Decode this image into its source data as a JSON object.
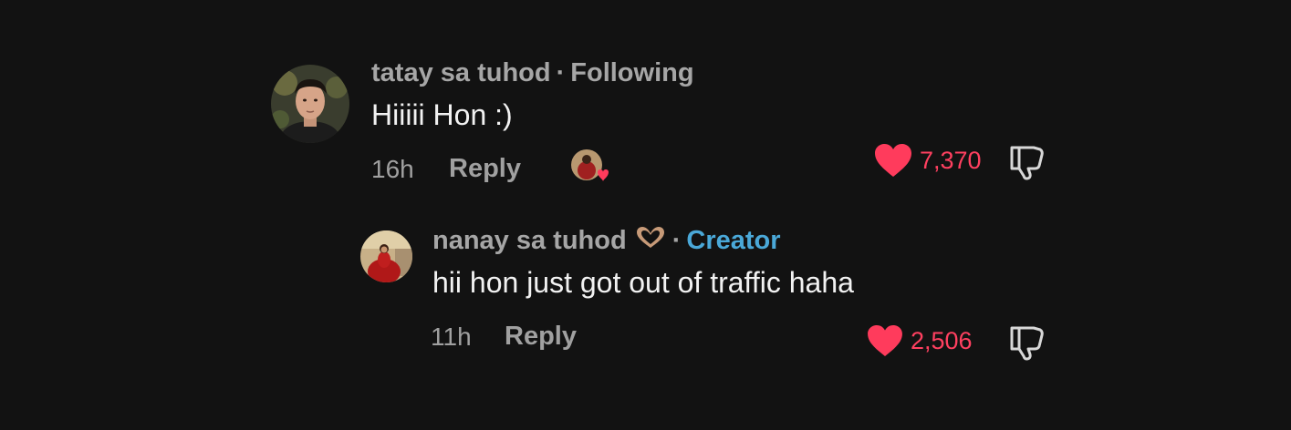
{
  "comments": [
    {
      "username": "tatay sa tuhod",
      "separator": "·",
      "status": "Following",
      "text": "Hiiiii Hon :)",
      "time": "16h",
      "reply_label": "Reply",
      "likes": "7,370"
    },
    {
      "username": "nanay sa tuhod",
      "separator": "·",
      "status": "Creator",
      "text": "hii hon just got out of traffic haha",
      "time": "11h",
      "reply_label": "Reply",
      "likes": "2,506"
    }
  ],
  "colors": {
    "background": "#121212",
    "like_red": "#ff3b5c",
    "creator_blue": "#4aa8d8",
    "muted_text": "#a0a0a0"
  }
}
